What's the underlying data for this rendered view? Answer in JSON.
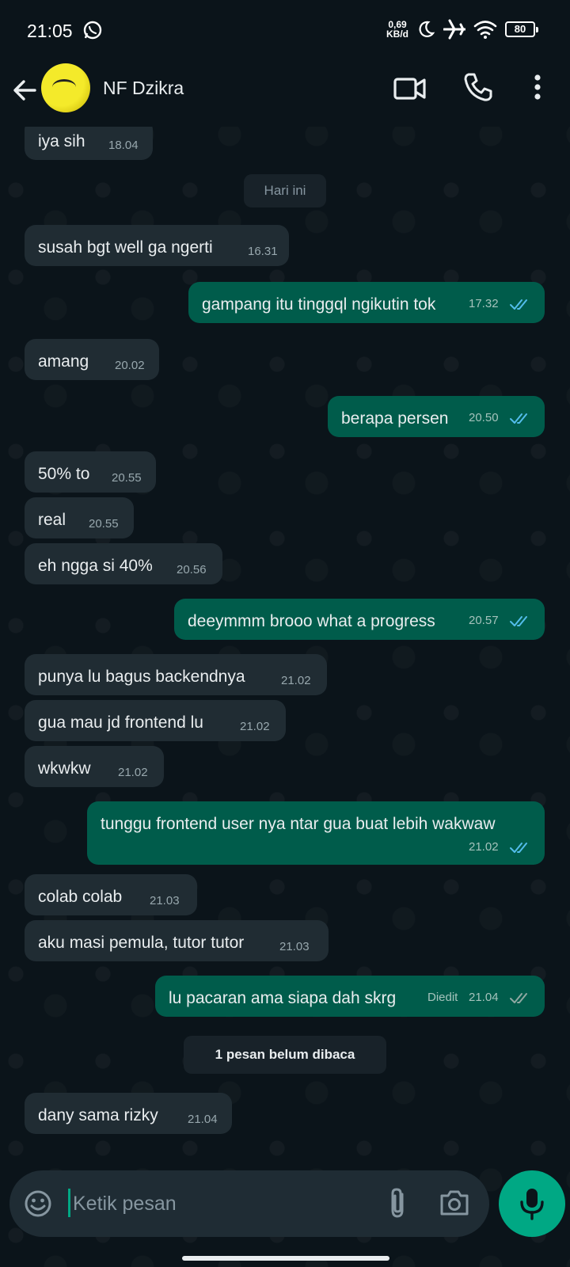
{
  "status_bar": {
    "time": "21:05",
    "net_speed_value": "0,69",
    "net_speed_unit": "KB/d",
    "battery": "80",
    "icons": [
      "whatsapp-icon",
      "moon-icon",
      "airplane-icon",
      "wifi-icon",
      "battery-icon"
    ]
  },
  "header": {
    "contact_name": "NF Dzikra",
    "icons": [
      "back-arrow-icon",
      "video-call-icon",
      "phone-call-icon",
      "more-vert-icon"
    ]
  },
  "chat": {
    "date_separator": "Hari ini",
    "unread_separator": "1 pesan belum dibaca",
    "messages": [
      {
        "dir": "in",
        "text": "iya sih",
        "time": "18.04"
      },
      {
        "dir": "in",
        "text": "susah bgt well ga ngerti",
        "time": "16.31"
      },
      {
        "dir": "out",
        "text": "gampang itu tinggql ngikutin tok",
        "time": "17.32",
        "status": "read"
      },
      {
        "dir": "in",
        "text": "amang",
        "time": "20.02"
      },
      {
        "dir": "out",
        "text": "berapa persen",
        "time": "20.50",
        "status": "read"
      },
      {
        "dir": "in",
        "text": "50% to",
        "time": "20.55"
      },
      {
        "dir": "in",
        "text": "real",
        "time": "20.55"
      },
      {
        "dir": "in",
        "text": "eh ngga si 40%",
        "time": "20.56"
      },
      {
        "dir": "out",
        "text": "deeymmm brooo what a progress",
        "time": "20.57",
        "status": "read"
      },
      {
        "dir": "in",
        "text": "punya lu bagus backendnya",
        "time": "21.02"
      },
      {
        "dir": "in",
        "text": "gua mau jd frontend lu",
        "time": "21.02"
      },
      {
        "dir": "in",
        "text": "wkwkw",
        "time": "21.02"
      },
      {
        "dir": "out",
        "text": "tunggu frontend user nya ntar gua buat lebih wakwaw",
        "time": "21.02",
        "status": "read"
      },
      {
        "dir": "in",
        "text": "colab colab",
        "time": "21.03"
      },
      {
        "dir": "in",
        "text": "aku masi pemula, tutor tutor",
        "time": "21.03"
      },
      {
        "dir": "out",
        "text": "lu pacaran ama siapa dah skrg",
        "time": "21.04",
        "edited_label": "Diedit",
        "status": "delivered"
      },
      {
        "dir": "in",
        "text": "dany sama rizky",
        "time": "21.04"
      }
    ]
  },
  "composer": {
    "placeholder": "Ketik pesan",
    "icons": [
      "emoji-icon",
      "attach-icon",
      "camera-icon",
      "mic-icon"
    ]
  },
  "colors": {
    "background": "#0b141a",
    "incoming_bubble": "#202c33",
    "outgoing_bubble": "#005c4b",
    "accent": "#00a884",
    "read_ticks": "#53bdeb"
  }
}
